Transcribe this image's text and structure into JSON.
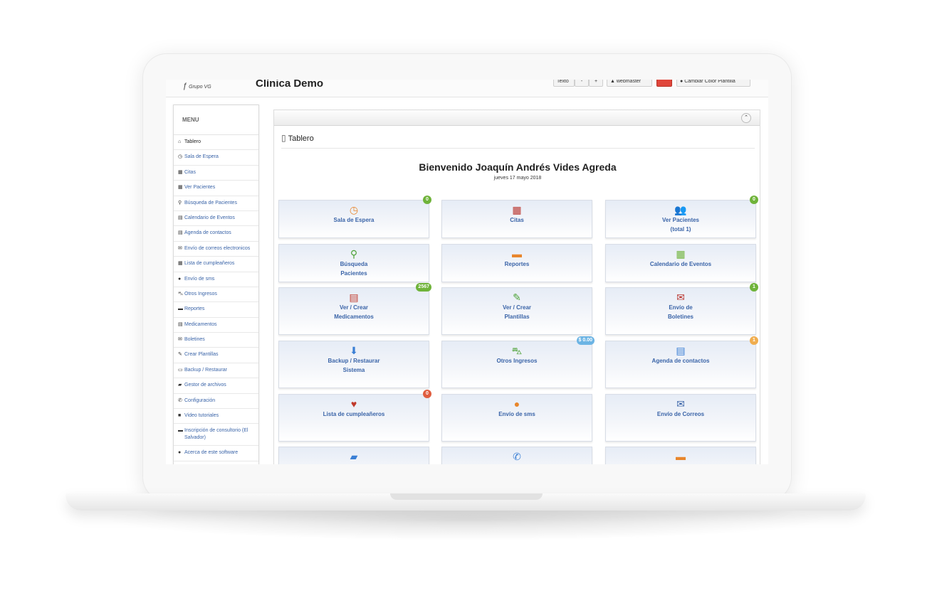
{
  "header": {
    "logo_text": "Grupo VG",
    "clinic_name": "Clínica Demo",
    "btn_text": "Texto",
    "btn_minus": "-",
    "btn_plus": "+",
    "btn_user": "webmaster",
    "btn_color": "Cambiar Color Plantilla"
  },
  "menu": {
    "title": "MENU",
    "items": [
      {
        "label": "Tablero",
        "icon": "⌂"
      },
      {
        "label": "Sala de Espera",
        "icon": "◷"
      },
      {
        "label": "Citas",
        "icon": "▦"
      },
      {
        "label": "Ver Pacientes",
        "icon": "▦"
      },
      {
        "label": "Búsqueda de Pacientes",
        "icon": "⚲"
      },
      {
        "label": "Calendario de Eventos",
        "icon": "▤"
      },
      {
        "label": "Agenda de contactos",
        "icon": "▤"
      },
      {
        "label": "Envío de correos electronicos",
        "icon": "✉"
      },
      {
        "label": "Lista de cumpleañeros",
        "icon": "▦"
      },
      {
        "label": "Envío de sms",
        "icon": "●"
      },
      {
        "label": "Otros Ingresos",
        "icon": "⛍"
      },
      {
        "label": "Reportes",
        "icon": "▬"
      },
      {
        "label": "Medicamentos",
        "icon": "▤"
      },
      {
        "label": "Boletines",
        "icon": "✉"
      },
      {
        "label": "Crear Plantillas",
        "icon": "✎"
      },
      {
        "label": "Backup / Restaurar",
        "icon": "▭"
      },
      {
        "label": "Gestor de archivos",
        "icon": "▰"
      },
      {
        "label": "Configuración",
        "icon": "✆"
      },
      {
        "label": "Video tutoriales",
        "icon": "■"
      },
      {
        "label": "Inscripción de consultorio (El Salvador)",
        "icon": "▬"
      },
      {
        "label": "Acerca de este software",
        "icon": "●"
      }
    ]
  },
  "breadcrumb": {
    "label": "Tablero"
  },
  "welcome": {
    "title": "Bienvenido Joaquín Andrés Vides Agreda",
    "date": "jueves 17 mayo 2018"
  },
  "tiles": [
    {
      "label": "Sala de Espera",
      "icon": "◷",
      "icon_color": "#e8862c",
      "badge": "0",
      "badge_color": "#6fb33a"
    },
    {
      "label": "Citas",
      "icon": "▦",
      "icon_color": "#b9322b",
      "badge": "",
      "badge_color": ""
    },
    {
      "label": "Ver Pacientes\n(total 1)",
      "icon": "👥",
      "icon_color": "#e8862c",
      "badge": "0",
      "badge_color": "#6fb33a"
    },
    {
      "label": "Búsqueda\nPacientes",
      "icon": "⚲",
      "icon_color": "#4ea338",
      "badge": "",
      "badge_color": ""
    },
    {
      "label": "Reportes",
      "icon": "▬",
      "icon_color": "#e8862c",
      "badge": "",
      "badge_color": ""
    },
    {
      "label": "Calendario de Eventos",
      "icon": "▦",
      "icon_color": "#6fb33a",
      "badge": "",
      "badge_color": ""
    },
    {
      "label": "Ver / Crear\nMedicamentos",
      "icon": "▤",
      "icon_color": "#c0392b",
      "badge": "2567",
      "badge_color": "#6fb33a"
    },
    {
      "label": "Ver / Crear\nPlantillas",
      "icon": "✎",
      "icon_color": "#4ea338",
      "badge": "",
      "badge_color": ""
    },
    {
      "label": "Envío de\nBoletines",
      "icon": "✉",
      "icon_color": "#b9322b",
      "badge": "1",
      "badge_color": "#6fb33a"
    },
    {
      "label": "Backup / Restaurar\nSistema",
      "icon": "⬇",
      "icon_color": "#3a7fd5",
      "badge": "",
      "badge_color": ""
    },
    {
      "label": "Otros Ingresos",
      "icon": "⛍",
      "icon_color": "#4ea338",
      "badge": "$ 0.00",
      "badge_color": "#6cb4e4"
    },
    {
      "label": "Agenda de contactos",
      "icon": "▤",
      "icon_color": "#3a7fd5",
      "badge": "1",
      "badge_color": "#f0ad4e"
    },
    {
      "label": "Lista de cumpleañeros",
      "icon": "♥",
      "icon_color": "#c0392b",
      "badge": "0",
      "badge_color": "#e05d3f"
    },
    {
      "label": "Envío de sms",
      "icon": "●",
      "icon_color": "#e8862c",
      "badge": "",
      "badge_color": ""
    },
    {
      "label": "Envío de Correos",
      "icon": "✉",
      "icon_color": "#3a64a8",
      "badge": "",
      "badge_color": ""
    },
    {
      "label": "",
      "icon": "▰",
      "icon_color": "#3a7fd5",
      "badge": "",
      "badge_color": ""
    },
    {
      "label": "",
      "icon": "✆",
      "icon_color": "#3a7fd5",
      "badge": "",
      "badge_color": ""
    },
    {
      "label": "",
      "icon": "▬",
      "icon_color": "#e8862c",
      "badge": "",
      "badge_color": ""
    }
  ]
}
